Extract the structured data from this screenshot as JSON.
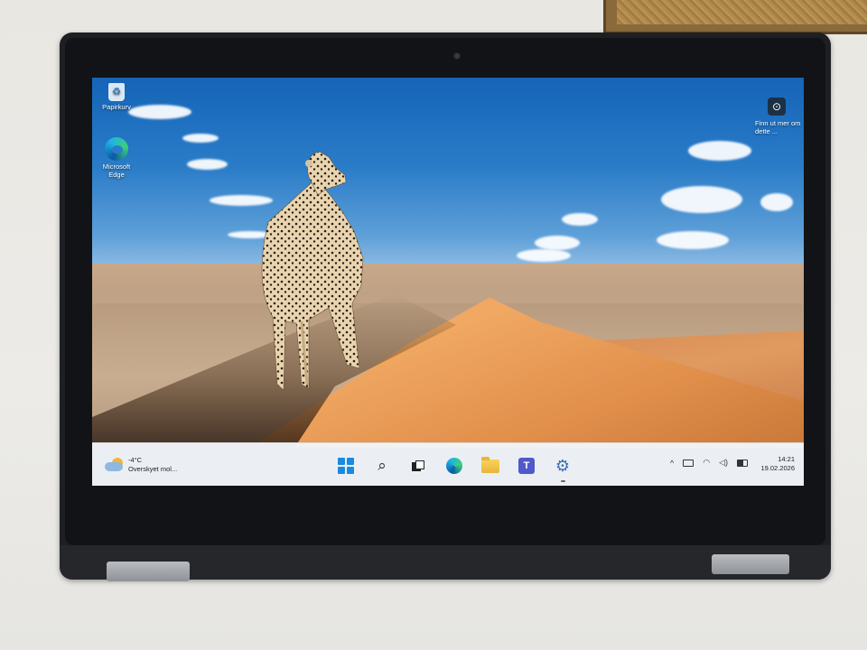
{
  "desktop": {
    "icons": [
      {
        "label": "Papirkurv",
        "icon": "recycle-bin-icon"
      },
      {
        "label": "Microsoft Edge",
        "icon": "edge-icon"
      }
    ],
    "spotlight": {
      "icon": "spotlight-icon",
      "label": "Finn ut mer om dette ..."
    }
  },
  "taskbar": {
    "weather": {
      "temp": "-4°C",
      "condition": "Overskyet mol...",
      "icon": "partly-cloudy-icon"
    },
    "apps": [
      {
        "name": "start",
        "icon": "windows-logo-icon"
      },
      {
        "name": "search",
        "icon": "search-icon"
      },
      {
        "name": "task-view",
        "icon": "task-view-icon"
      },
      {
        "name": "edge",
        "icon": "edge-icon"
      },
      {
        "name": "file-explorer",
        "icon": "folder-icon"
      },
      {
        "name": "teams",
        "icon": "teams-icon"
      },
      {
        "name": "settings",
        "icon": "gear-icon",
        "active": true
      }
    ],
    "tray": {
      "chevron": "^",
      "icons": [
        "keyboard-icon",
        "wifi-icon",
        "volume-icon",
        "battery-icon"
      ]
    },
    "clock": {
      "time": "14:21",
      "date": "19.02.2026"
    }
  },
  "colors": {
    "taskbar_bg": "#f3f5f8",
    "sky": "#1564b8",
    "sand": "#eaa15c",
    "accent": "#1a8ae0"
  }
}
